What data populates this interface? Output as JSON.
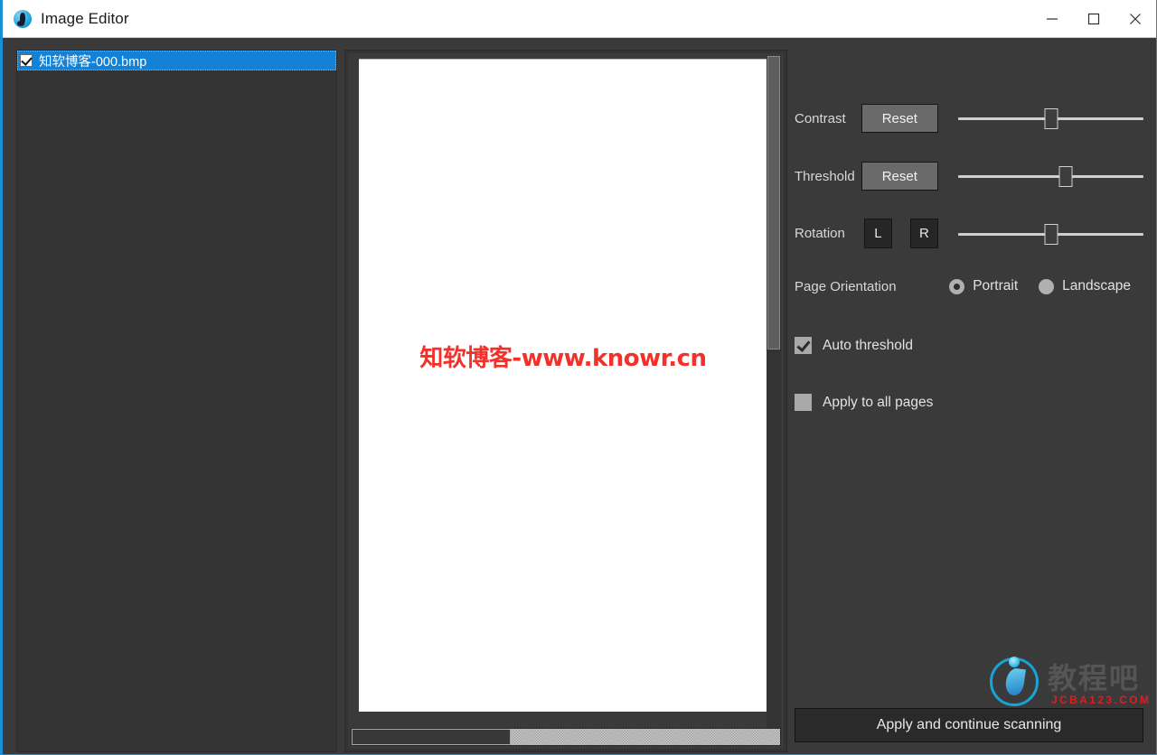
{
  "window": {
    "title": "Image Editor",
    "icon": "app-note-icon",
    "controls": {
      "minimize": "minimize-icon",
      "maximize": "maximize-icon",
      "close": "close-icon"
    },
    "accent_color": "#1a8fd8",
    "background_color": "#3a3a3a"
  },
  "file_list": {
    "items": [
      {
        "label": "知软博客-000.bmp",
        "checked": true,
        "selected": true
      }
    ],
    "selection_color": "#1281d6"
  },
  "preview": {
    "page_watermark": "知软博客-www.knowr.cn",
    "watermark_color": "#f3312a",
    "v_scrollbar": {
      "name": "vertical-scrollbar"
    },
    "h_scrollbar": {
      "name": "horizontal-scrollbar"
    }
  },
  "controls": {
    "contrast": {
      "label": "Contrast",
      "reset_label": "Reset",
      "slider_percent": 50
    },
    "threshold": {
      "label": "Threshold",
      "reset_label": "Reset",
      "slider_percent": 58
    },
    "rotation": {
      "label": "Rotation",
      "left_label": "L",
      "right_label": "R",
      "slider_percent": 50
    },
    "page_orientation": {
      "label": "Page Orientation",
      "options": [
        {
          "label": "Portrait",
          "selected": true
        },
        {
          "label": "Landscape",
          "selected": false
        }
      ]
    },
    "auto_threshold": {
      "label": "Auto threshold",
      "checked": true
    },
    "apply_all_pages": {
      "label": "Apply to all pages",
      "checked": false
    },
    "apply_button": {
      "label": "Apply and continue scanning"
    }
  },
  "corner_watermark": {
    "cn_text": "教程吧",
    "url_text": "JCBA123.COM",
    "logo": "water-drop-icon",
    "url_color": "#e01d1d"
  }
}
